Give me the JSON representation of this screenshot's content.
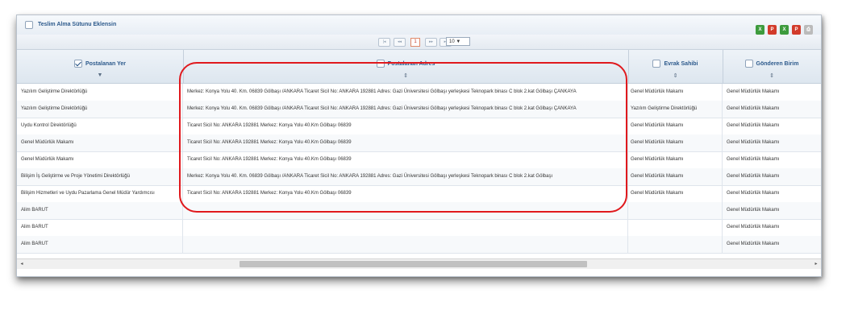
{
  "toolbar": {
    "teslim_label": "Teslim Alma Sütunu Eklensin",
    "teslim_checked": false,
    "export_icons": [
      "excel-icon",
      "pdf-icon",
      "excel-icon",
      "pdf-icon",
      "print-icon"
    ]
  },
  "pager": {
    "first": "|◂",
    "prev": "◂◂",
    "page": "1",
    "next": "▸▸",
    "last": "▸|",
    "page_size": "10 ▼"
  },
  "columns": [
    {
      "label": "Postalanan Yer",
      "checked": true,
      "sort": "▼"
    },
    {
      "label": "Postalanan Adres",
      "checked": false,
      "sort": "⇕"
    },
    {
      "label": "Evrak Sahibi",
      "checked": false,
      "sort": "⇕"
    },
    {
      "label": "Gönderen Birim",
      "checked": false,
      "sort": "⇕"
    }
  ],
  "rows": [
    [
      "Yazılım Geliştirme Direktörlüğü",
      "Merkez: Konya Yolu 40. Km. 06839 Gölbaşı /ANKARA Ticaret Sicil No: ANKARA 192881 Adres: Gazi Üniversitesi Gölbaşı yerleşkesi Teknopark binası C blok 2.kat Gölbaşı ÇANKAYA",
      "Genel Müdürlük Makamı",
      "Genel Müdürlük Makamı"
    ],
    [
      "Yazılım Geliştirme Direktörlüğü",
      "Merkez: Konya Yolu 40. Km. 06839 Gölbaşı /ANKARA Ticaret Sicil No: ANKARA 192881 Adres: Gazi Üniversitesi Gölbaşı yerleşkesi Teknopark binası C blok 2.kat Gölbaşı ÇANKAYA",
      "Yazılım Geliştirme Direktörlüğü",
      "Genel Müdürlük Makamı"
    ],
    [
      "Uydu Kontrol Direktörlüğü",
      "Ticaret Sicil No: ANKARA 192881 Merkez: Konya Yolu 40.Km Gölbaşı 06839",
      "Genel Müdürlük Makamı",
      "Genel Müdürlük Makamı"
    ],
    [
      "Genel Müdürlük Makamı",
      "Ticaret Sicil No: ANKARA 192881 Merkez: Konya Yolu 40.Km Gölbaşı 06839",
      "Genel Müdürlük Makamı",
      "Genel Müdürlük Makamı"
    ],
    [
      "Genel Müdürlük Makamı",
      "Ticaret Sicil No: ANKARA 192881 Merkez: Konya Yolu 40.Km Gölbaşı 06839",
      "Genel Müdürlük Makamı",
      "Genel Müdürlük Makamı"
    ],
    [
      "Bilişim İş Geliştirme ve Proje Yönetimi Direktörlüğü",
      "Merkez: Konya Yolu 40. Km. 06839 Gölbaşı /ANKARA Ticaret Sicil No: ANKARA 192881 Adres: Gazi Üniversitesi Gölbaşı yerleşkesi Teknopark binası C blok 2.kat Gölbaşı",
      "Genel Müdürlük Makamı",
      "Genel Müdürlük Makamı"
    ],
    [
      "Bilişim Hizmetleri ve Uydu Pazarlama Genel Müdür Yardımcısı",
      "Ticaret Sicil No: ANKARA 192881 Merkez: Konya Yolu 40.Km Gölbaşı 06839",
      "Genel Müdürlük Makamı",
      "Genel Müdürlük Makamı"
    ],
    [
      "Alim BARUT",
      "",
      "",
      "Genel Müdürlük Makamı"
    ],
    [
      "Alim BARUT",
      "",
      "",
      "Genel Müdürlük Makamı"
    ],
    [
      "Alim BARUT",
      "",
      "",
      "Genel Müdürlük Makamı"
    ]
  ],
  "scrollbar": {
    "left_arrow": "◂",
    "right_arrow": "▸"
  }
}
